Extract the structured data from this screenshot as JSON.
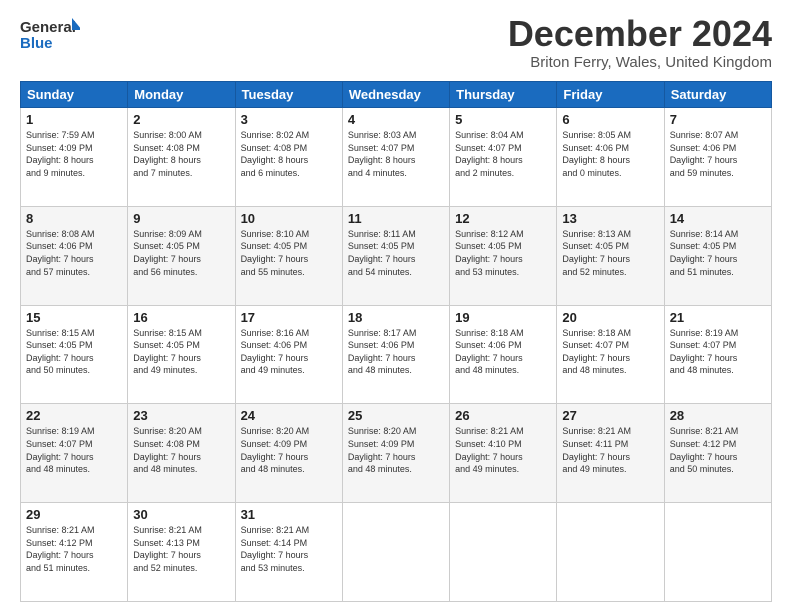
{
  "logo": {
    "line1": "General",
    "line2": "Blue"
  },
  "title": "December 2024",
  "location": "Briton Ferry, Wales, United Kingdom",
  "days_of_week": [
    "Sunday",
    "Monday",
    "Tuesday",
    "Wednesday",
    "Thursday",
    "Friday",
    "Saturday"
  ],
  "weeks": [
    [
      {
        "day": "1",
        "info": "Sunrise: 7:59 AM\nSunset: 4:09 PM\nDaylight: 8 hours\nand 9 minutes."
      },
      {
        "day": "2",
        "info": "Sunrise: 8:00 AM\nSunset: 4:08 PM\nDaylight: 8 hours\nand 7 minutes."
      },
      {
        "day": "3",
        "info": "Sunrise: 8:02 AM\nSunset: 4:08 PM\nDaylight: 8 hours\nand 6 minutes."
      },
      {
        "day": "4",
        "info": "Sunrise: 8:03 AM\nSunset: 4:07 PM\nDaylight: 8 hours\nand 4 minutes."
      },
      {
        "day": "5",
        "info": "Sunrise: 8:04 AM\nSunset: 4:07 PM\nDaylight: 8 hours\nand 2 minutes."
      },
      {
        "day": "6",
        "info": "Sunrise: 8:05 AM\nSunset: 4:06 PM\nDaylight: 8 hours\nand 0 minutes."
      },
      {
        "day": "7",
        "info": "Sunrise: 8:07 AM\nSunset: 4:06 PM\nDaylight: 7 hours\nand 59 minutes."
      }
    ],
    [
      {
        "day": "8",
        "info": "Sunrise: 8:08 AM\nSunset: 4:06 PM\nDaylight: 7 hours\nand 57 minutes."
      },
      {
        "day": "9",
        "info": "Sunrise: 8:09 AM\nSunset: 4:05 PM\nDaylight: 7 hours\nand 56 minutes."
      },
      {
        "day": "10",
        "info": "Sunrise: 8:10 AM\nSunset: 4:05 PM\nDaylight: 7 hours\nand 55 minutes."
      },
      {
        "day": "11",
        "info": "Sunrise: 8:11 AM\nSunset: 4:05 PM\nDaylight: 7 hours\nand 54 minutes."
      },
      {
        "day": "12",
        "info": "Sunrise: 8:12 AM\nSunset: 4:05 PM\nDaylight: 7 hours\nand 53 minutes."
      },
      {
        "day": "13",
        "info": "Sunrise: 8:13 AM\nSunset: 4:05 PM\nDaylight: 7 hours\nand 52 minutes."
      },
      {
        "day": "14",
        "info": "Sunrise: 8:14 AM\nSunset: 4:05 PM\nDaylight: 7 hours\nand 51 minutes."
      }
    ],
    [
      {
        "day": "15",
        "info": "Sunrise: 8:15 AM\nSunset: 4:05 PM\nDaylight: 7 hours\nand 50 minutes."
      },
      {
        "day": "16",
        "info": "Sunrise: 8:15 AM\nSunset: 4:05 PM\nDaylight: 7 hours\nand 49 minutes."
      },
      {
        "day": "17",
        "info": "Sunrise: 8:16 AM\nSunset: 4:06 PM\nDaylight: 7 hours\nand 49 minutes."
      },
      {
        "day": "18",
        "info": "Sunrise: 8:17 AM\nSunset: 4:06 PM\nDaylight: 7 hours\nand 48 minutes."
      },
      {
        "day": "19",
        "info": "Sunrise: 8:18 AM\nSunset: 4:06 PM\nDaylight: 7 hours\nand 48 minutes."
      },
      {
        "day": "20",
        "info": "Sunrise: 8:18 AM\nSunset: 4:07 PM\nDaylight: 7 hours\nand 48 minutes."
      },
      {
        "day": "21",
        "info": "Sunrise: 8:19 AM\nSunset: 4:07 PM\nDaylight: 7 hours\nand 48 minutes."
      }
    ],
    [
      {
        "day": "22",
        "info": "Sunrise: 8:19 AM\nSunset: 4:07 PM\nDaylight: 7 hours\nand 48 minutes."
      },
      {
        "day": "23",
        "info": "Sunrise: 8:20 AM\nSunset: 4:08 PM\nDaylight: 7 hours\nand 48 minutes."
      },
      {
        "day": "24",
        "info": "Sunrise: 8:20 AM\nSunset: 4:09 PM\nDaylight: 7 hours\nand 48 minutes."
      },
      {
        "day": "25",
        "info": "Sunrise: 8:20 AM\nSunset: 4:09 PM\nDaylight: 7 hours\nand 48 minutes."
      },
      {
        "day": "26",
        "info": "Sunrise: 8:21 AM\nSunset: 4:10 PM\nDaylight: 7 hours\nand 49 minutes."
      },
      {
        "day": "27",
        "info": "Sunrise: 8:21 AM\nSunset: 4:11 PM\nDaylight: 7 hours\nand 49 minutes."
      },
      {
        "day": "28",
        "info": "Sunrise: 8:21 AM\nSunset: 4:12 PM\nDaylight: 7 hours\nand 50 minutes."
      }
    ],
    [
      {
        "day": "29",
        "info": "Sunrise: 8:21 AM\nSunset: 4:12 PM\nDaylight: 7 hours\nand 51 minutes."
      },
      {
        "day": "30",
        "info": "Sunrise: 8:21 AM\nSunset: 4:13 PM\nDaylight: 7 hours\nand 52 minutes."
      },
      {
        "day": "31",
        "info": "Sunrise: 8:21 AM\nSunset: 4:14 PM\nDaylight: 7 hours\nand 53 minutes."
      },
      {
        "day": "",
        "info": ""
      },
      {
        "day": "",
        "info": ""
      },
      {
        "day": "",
        "info": ""
      },
      {
        "day": "",
        "info": ""
      }
    ]
  ]
}
